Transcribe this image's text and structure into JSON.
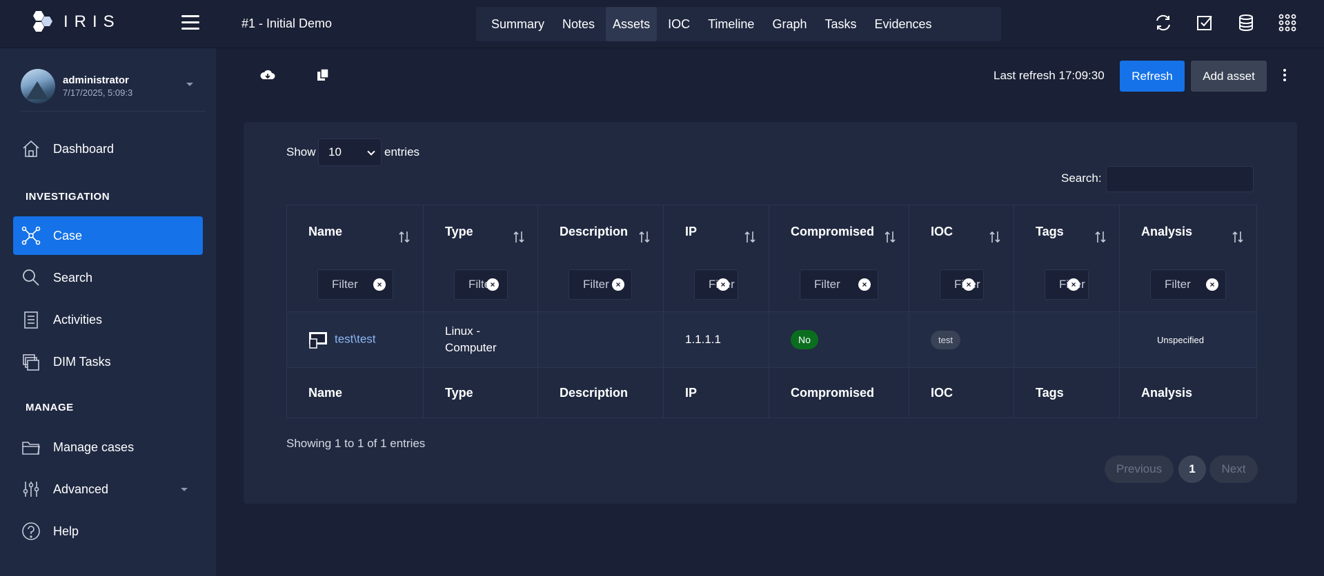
{
  "app": {
    "brand": "IRIS"
  },
  "header": {
    "case_title": "#1 - Initial Demo",
    "tabs": [
      {
        "label": "Summary",
        "active": false
      },
      {
        "label": "Notes",
        "active": false
      },
      {
        "label": "Assets",
        "active": true
      },
      {
        "label": "IOC",
        "active": false
      },
      {
        "label": "Timeline",
        "active": false
      },
      {
        "label": "Graph",
        "active": false
      },
      {
        "label": "Tasks",
        "active": false
      },
      {
        "label": "Evidences",
        "active": false
      }
    ],
    "icons": [
      "refresh-cycle-icon",
      "checkbox-icon",
      "database-icon",
      "apps-grid-icon"
    ]
  },
  "user": {
    "name": "administrator",
    "date": "7/17/2025, 5:09:3"
  },
  "sidebar": {
    "items": [
      {
        "label": "Dashboard",
        "icon": "home-icon"
      },
      {
        "section": "INVESTIGATION"
      },
      {
        "label": "Case",
        "icon": "network-icon",
        "active": true
      },
      {
        "label": "Search",
        "icon": "search-icon"
      },
      {
        "label": "Activities",
        "icon": "clipboard-icon"
      },
      {
        "label": "DIM Tasks",
        "icon": "stack-icon"
      },
      {
        "section": "MANAGE"
      },
      {
        "label": "Manage cases",
        "icon": "folder-icon"
      },
      {
        "label": "Advanced",
        "icon": "sliders-icon"
      },
      {
        "label": "Help",
        "icon": "help-icon"
      }
    ]
  },
  "toolbar": {
    "last_refresh": "Last refresh 17:09:30",
    "refresh_label": "Refresh",
    "add_label": "Add asset",
    "accent": "#1572e8"
  },
  "table": {
    "show_label": "Show",
    "page_length": "10",
    "entries_label": "entries",
    "search_label": "Search:",
    "search_value": "",
    "columns": [
      "Name",
      "Type",
      "Description",
      "IP",
      "Compromised",
      "IOC",
      "Tags",
      "Analysis"
    ],
    "filter_placeholder": "Filter",
    "rows": [
      {
        "name": "test\\test",
        "type_line1": "Linux -",
        "type_line2": "Computer",
        "description": "",
        "ip": "1.1.1.1",
        "compromised": "No",
        "ioc": "test",
        "tags": "",
        "analysis": "Unspecified"
      }
    ],
    "showing": "Showing 1 to 1 of 1 entries",
    "pager": {
      "prev": "Previous",
      "page": "1",
      "next": "Next"
    }
  }
}
